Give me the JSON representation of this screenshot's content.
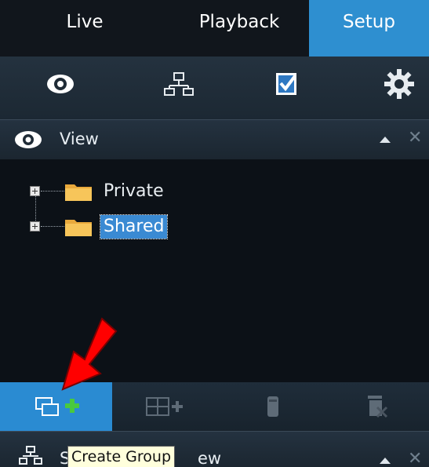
{
  "tabs": {
    "live": "Live",
    "playback": "Playback",
    "setup": "Setup",
    "active": "Setup"
  },
  "toolbar_icons": [
    "eye-icon",
    "network-icon",
    "checklist-icon",
    "gear-icon"
  ],
  "panel": {
    "title": "View",
    "icon": "eye-icon",
    "close_glyph": "✕"
  },
  "tree": {
    "items": [
      {
        "label": "Private",
        "selected": false
      },
      {
        "label": "Shared",
        "selected": true
      }
    ]
  },
  "bottom_toolbar": {
    "buttons": [
      {
        "name": "create-group-button",
        "icon": "create-group-icon",
        "active": true
      },
      {
        "name": "add-layout-button",
        "icon": "grid-add-icon",
        "active": false
      },
      {
        "name": "trash-button",
        "icon": "trash-icon",
        "active": false
      },
      {
        "name": "delete-group-button",
        "icon": "delete-icon",
        "active": false
      }
    ]
  },
  "panel2": {
    "title_left": "S",
    "title_right": "ew",
    "close_glyph": "✕"
  },
  "tooltip": {
    "text": "Create Group"
  },
  "colors": {
    "accent": "#2e8fd0",
    "selected": "#3a8ad3",
    "annotation_arrow": "#ff0000",
    "tooltip_bg": "#ffffdc"
  }
}
